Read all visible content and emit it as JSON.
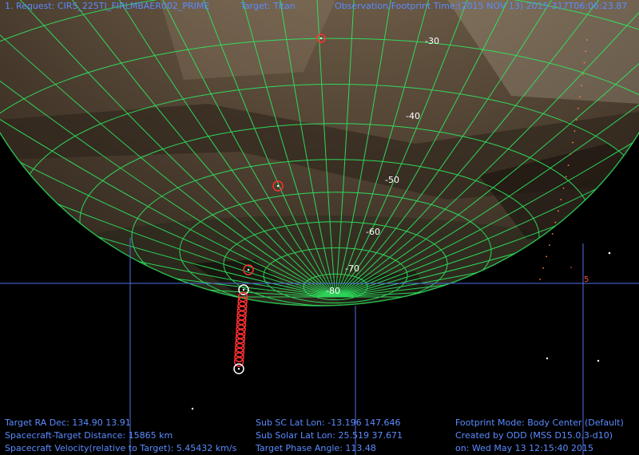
{
  "header": {
    "request": "1. Request: CIRS_225TI_FIRLMBAER002_PRIME",
    "target": "Target: Titan",
    "obs_time": "Observation/Footprint Time:(2015 NOV 13) 2015-317T06:06:23.87"
  },
  "lat_labels": [
    "-30",
    "-40",
    "-50",
    "-60",
    "-70",
    "-80"
  ],
  "stray_label": "5",
  "footer": {
    "col1": [
      "Target RA Dec: 134.90  13.91",
      "Spacecraft-Target Distance:   15865 km",
      "Spacecraft Velocity(relative to Target): 5.45432 km/s"
    ],
    "col2": [
      "Sub SC Lat Lon: -13.196  147.646",
      "Sub Solar Lat Lon: 25.519  37.671",
      "Target Phase Angle: 113.48"
    ],
    "col3": [
      "Footprint Mode: Body Center (Default)",
      "Created by ODD (MSS D15.0.3-d10)",
      "on: Wed May 13 12:15:40 2015"
    ]
  },
  "colors": {
    "text": "#5b8cff",
    "grid": "#2ee860",
    "footprint_red": "#ff3030",
    "footprint_white": "#ffffff",
    "axis_line": "#4f6fe0",
    "background": "#000000"
  }
}
